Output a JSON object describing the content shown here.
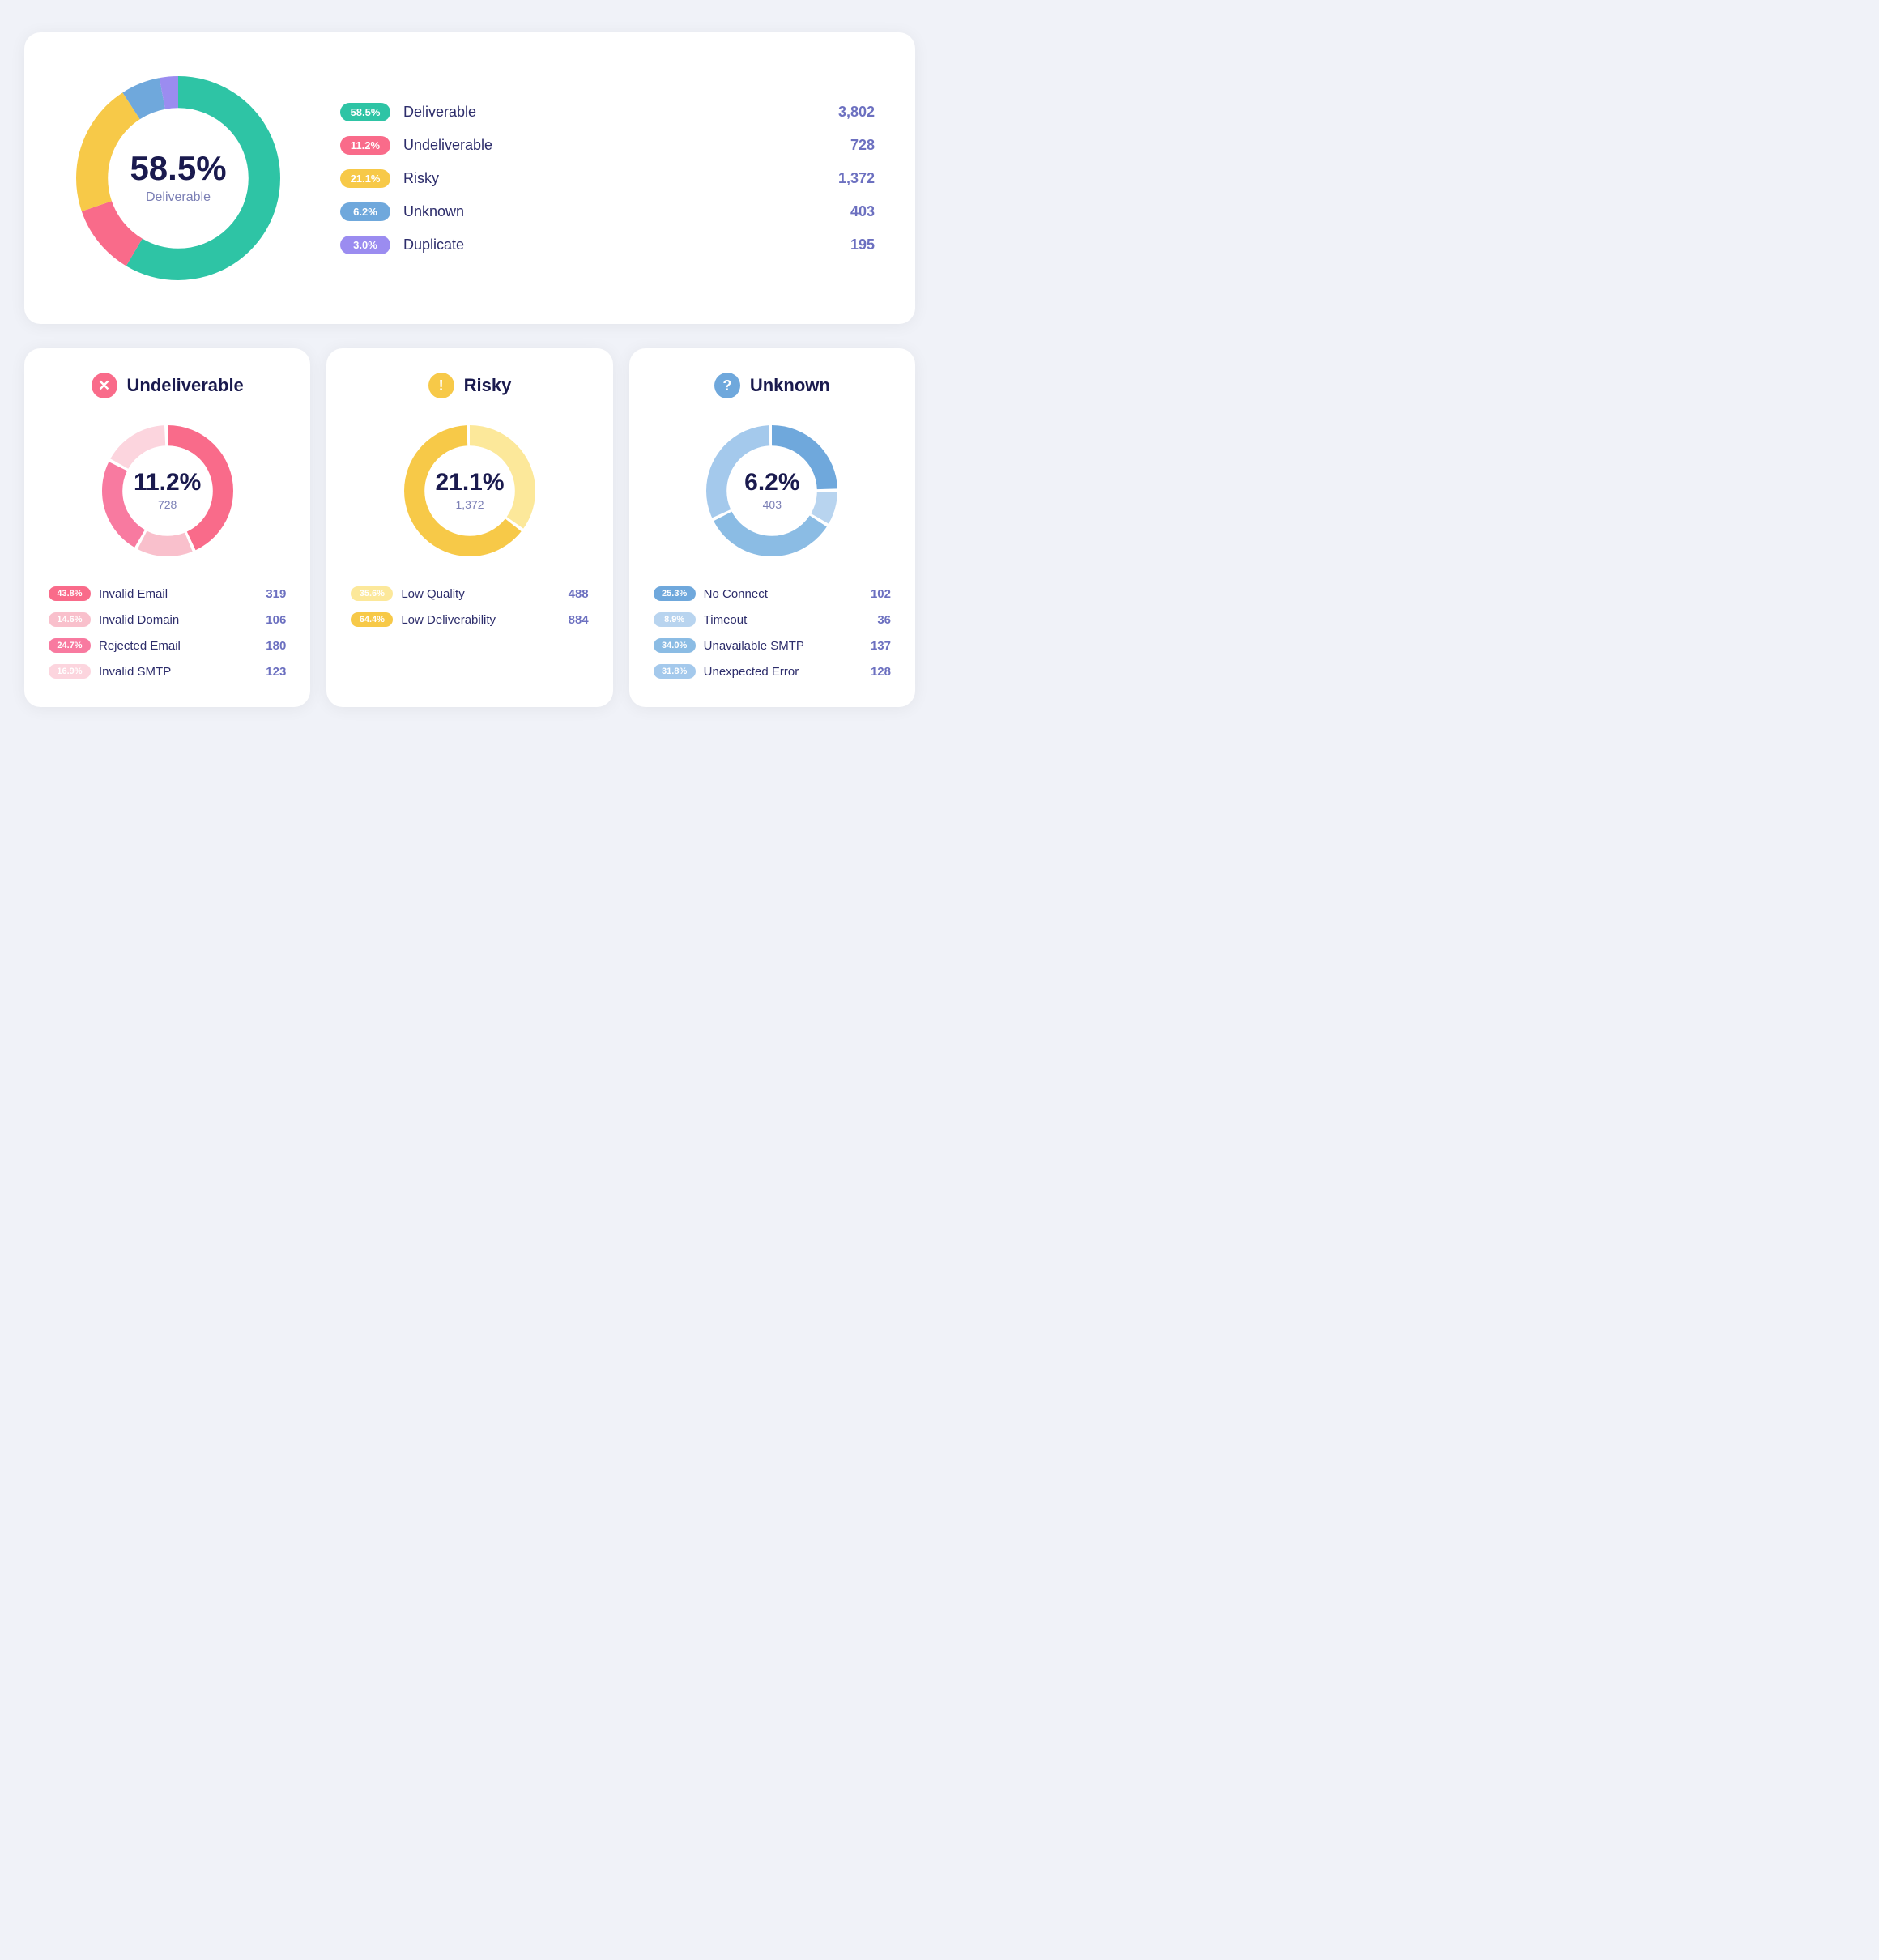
{
  "top": {
    "percent": "58.5%",
    "label": "Deliverable",
    "legend": [
      {
        "id": "deliverable",
        "badge_text": "58.5%",
        "color": "#2ec4a5",
        "name": "Deliverable",
        "count": "3,802"
      },
      {
        "id": "undeliverable",
        "badge_text": "11.2%",
        "color": "#f96b8a",
        "name": "Undeliverable",
        "count": "728"
      },
      {
        "id": "risky",
        "badge_text": "21.1%",
        "color": "#f7c948",
        "name": "Risky",
        "count": "1,372"
      },
      {
        "id": "unknown",
        "badge_text": "6.2%",
        "color": "#6fa8dc",
        "name": "Unknown",
        "count": "403"
      },
      {
        "id": "duplicate",
        "badge_text": "3.0%",
        "color": "#9b8cf0",
        "name": "Duplicate",
        "count": "195"
      }
    ]
  },
  "cards": [
    {
      "id": "undeliverable",
      "title": "Undeliverable",
      "icon_char": "✕",
      "icon_color": "#f96b8a",
      "percent": "11.2%",
      "count": "728",
      "color_main": "#f96b8a",
      "color_light": "#f9c0cc",
      "segments": [
        {
          "label": "Invalid Email",
          "pct": 43.8,
          "badge_text": "43.8%",
          "color": "#f96b8a",
          "count": "319"
        },
        {
          "label": "Invalid Domain",
          "pct": 14.6,
          "badge_text": "14.6%",
          "color": "#f9c0cc",
          "count": "106"
        },
        {
          "label": "Rejected Email",
          "pct": 24.7,
          "badge_text": "24.7%",
          "color": "#f87aa0",
          "count": "180"
        },
        {
          "label": "Invalid SMTP",
          "pct": 16.9,
          "badge_text": "16.9%",
          "color": "#fcd5de",
          "count": "123"
        }
      ]
    },
    {
      "id": "risky",
      "title": "Risky",
      "icon_char": "!",
      "icon_color": "#f7c948",
      "percent": "21.1%",
      "count": "1,372",
      "color_main": "#f7c948",
      "color_light": "#fce89a",
      "segments": [
        {
          "label": "Low Quality",
          "pct": 35.6,
          "badge_text": "35.6%",
          "color": "#fce89a",
          "count": "488"
        },
        {
          "label": "Low Deliverability",
          "pct": 64.4,
          "badge_text": "64.4%",
          "color": "#f7c948",
          "count": "884"
        }
      ]
    },
    {
      "id": "unknown",
      "title": "Unknown",
      "icon_char": "?",
      "icon_color": "#6fa8dc",
      "percent": "6.2%",
      "count": "403",
      "color_main": "#6fa8dc",
      "color_light": "#b8d4ef",
      "segments": [
        {
          "label": "No Connect",
          "pct": 25.3,
          "badge_text": "25.3%",
          "color": "#6fa8dc",
          "count": "102"
        },
        {
          "label": "Timeout",
          "pct": 8.9,
          "badge_text": "8.9%",
          "color": "#b8d4ef",
          "count": "36"
        },
        {
          "label": "Unavailable SMTP",
          "pct": 34.0,
          "badge_text": "34.0%",
          "color": "#8bbce4",
          "count": "137"
        },
        {
          "label": "Unexpected Error",
          "pct": 31.8,
          "badge_text": "31.8%",
          "color": "#a4c9ec",
          "count": "128"
        }
      ]
    }
  ]
}
